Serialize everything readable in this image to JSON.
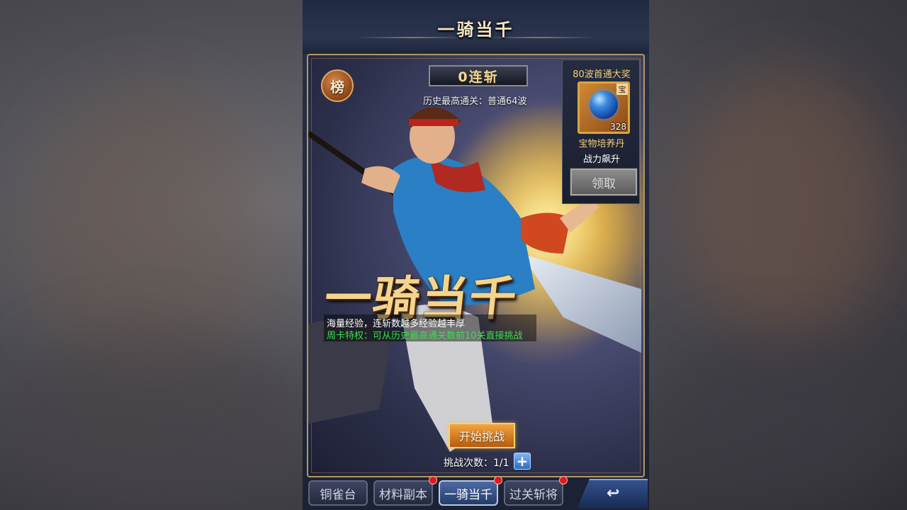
{
  "window_title": "一骑当千",
  "rank_button_label": "榜",
  "streak_label": "0连斩",
  "history_text": "历史最高通关：普通64波",
  "reward": {
    "title": "80波首通大奖",
    "item_tag": "宝",
    "item_count": "328",
    "item_name": "宝物培养丹",
    "item_desc": "战力飙升",
    "claim_label": "领取"
  },
  "logo_text": "一骑当千",
  "description": {
    "line1": "海量经验，连斩数越多经验越丰厚",
    "line2": "周卡特权：可从历史最高通关数前10关直接挑战"
  },
  "start_button_label": "开始挑战",
  "attempts_text": "挑战次数：1/1",
  "plus_label": "+",
  "tabs": [
    {
      "label": "铜雀台",
      "active": false,
      "badge": false
    },
    {
      "label": "材料副本",
      "active": false,
      "badge": true
    },
    {
      "label": "一骑当千",
      "active": true,
      "badge": true
    },
    {
      "label": "过关斩将",
      "active": false,
      "badge": true
    }
  ],
  "colors": {
    "accent_gold": "#f4d58e",
    "highlight_green": "#39e04a",
    "badge_red": "#e01818"
  }
}
